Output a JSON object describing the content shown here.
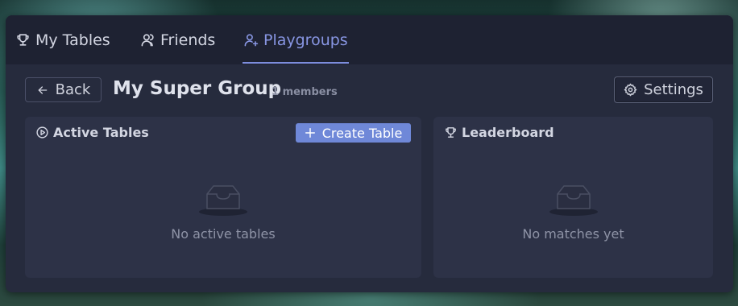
{
  "tabs": [
    {
      "label": "My Tables",
      "icon": "trophy-icon",
      "active": false
    },
    {
      "label": "Friends",
      "icon": "users-icon",
      "active": false
    },
    {
      "label": "Playgroups",
      "icon": "users-plus-icon",
      "active": true
    }
  ],
  "header": {
    "back_label": "Back",
    "title": "My Super Group",
    "members": "1 members",
    "settings_label": "Settings"
  },
  "active_tables": {
    "title": "Active Tables",
    "create_label": "Create Table",
    "empty_text": "No active tables"
  },
  "leaderboard": {
    "title": "Leaderboard",
    "empty_text": "No matches yet"
  },
  "colors": {
    "accent": "#7d8ddd",
    "button": "#6f88d8",
    "panel": "#2d3247",
    "window": "#262b3d"
  }
}
